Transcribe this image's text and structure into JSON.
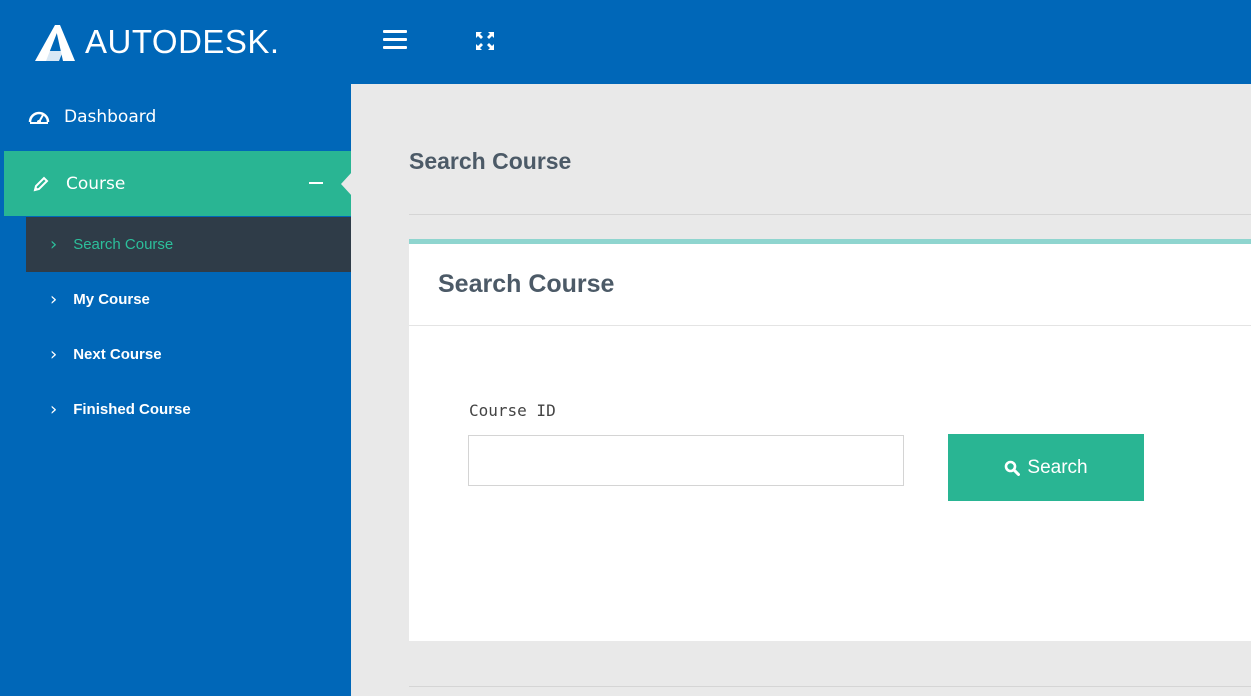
{
  "brand": {
    "name": "AUTODESK."
  },
  "sidebar": {
    "dashboard": "Dashboard",
    "course": "Course",
    "items": [
      {
        "label": "Search Course",
        "active": true
      },
      {
        "label": "My Course"
      },
      {
        "label": "Next Course"
      },
      {
        "label": "Finished Course"
      }
    ]
  },
  "main": {
    "page_title": "Search Course",
    "card_title": "Search Course",
    "field_label": "Course ID",
    "field_value": "",
    "field_placeholder": "",
    "button_label": "Search"
  },
  "colors": {
    "primary": "#0067b8",
    "accent": "#29b593",
    "active_bg": "#2f3c48",
    "active_text": "#2cbf9b"
  }
}
